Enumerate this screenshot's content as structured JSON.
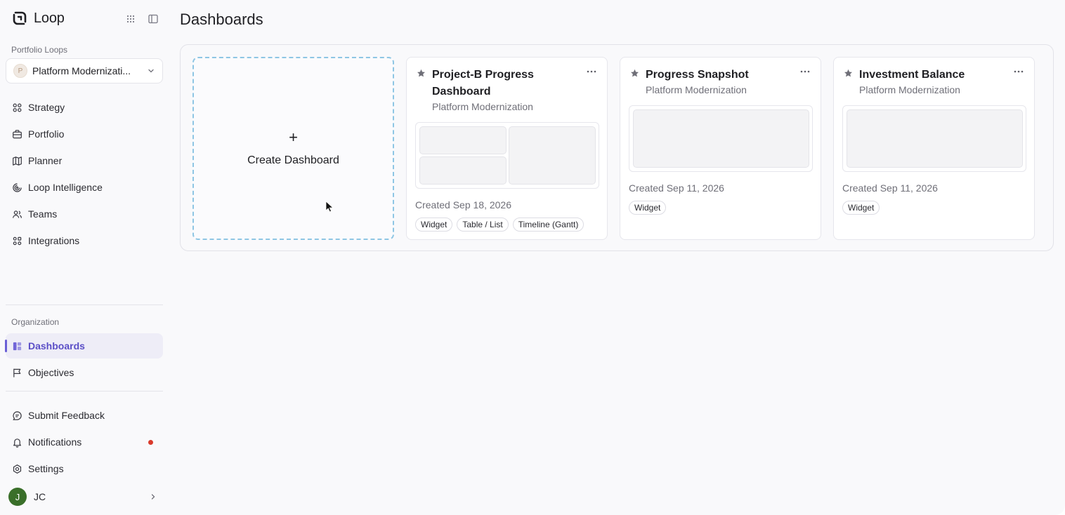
{
  "brand": {
    "name": "Loop"
  },
  "sidebar": {
    "portfolio_label": "Portfolio Loops",
    "loop_select": {
      "avatar": "P",
      "value": "Platform Modernizati..."
    },
    "nav": [
      {
        "label": "Strategy",
        "icon": "strategy-icon"
      },
      {
        "label": "Portfolio",
        "icon": "briefcase-icon"
      },
      {
        "label": "Planner",
        "icon": "map-icon"
      },
      {
        "label": "Loop Intelligence",
        "icon": "intelligence-icon"
      },
      {
        "label": "Teams",
        "icon": "users-icon"
      },
      {
        "label": "Integrations",
        "icon": "integrations-icon"
      }
    ],
    "org_label": "Organization",
    "org_nav": [
      {
        "label": "Dashboards",
        "icon": "dashboard-icon",
        "active": true
      },
      {
        "label": "Objectives",
        "icon": "flag-icon"
      }
    ],
    "bottom_nav": [
      {
        "label": "Submit Feedback",
        "icon": "feedback-icon"
      },
      {
        "label": "Notifications",
        "icon": "bell-icon",
        "badge": true
      },
      {
        "label": "Settings",
        "icon": "settings-icon"
      }
    ],
    "user": {
      "initial": "J",
      "name": "JC"
    }
  },
  "main": {
    "title": "Dashboards",
    "create": {
      "plus": "+",
      "label": "Create Dashboard"
    },
    "cards": [
      {
        "title": "Project-B Progress Dashboard",
        "subtitle": "Platform Modernization",
        "created": "Created Sep 18, 2026",
        "tags": [
          "Widget",
          "Table / List",
          "Timeline (Gantt)"
        ]
      },
      {
        "title": "Progress Snapshot",
        "subtitle": "Platform Modernization",
        "created": "Created Sep 11, 2026",
        "tags": [
          "Widget"
        ]
      },
      {
        "title": "Investment Balance",
        "subtitle": "Platform Modernization",
        "created": "Created Sep 11, 2026",
        "tags": [
          "Widget"
        ]
      }
    ]
  },
  "colors": {
    "accent": "#6a5fd6",
    "dashed_border": "#8ec6e4",
    "notification": "#d93a2b"
  }
}
